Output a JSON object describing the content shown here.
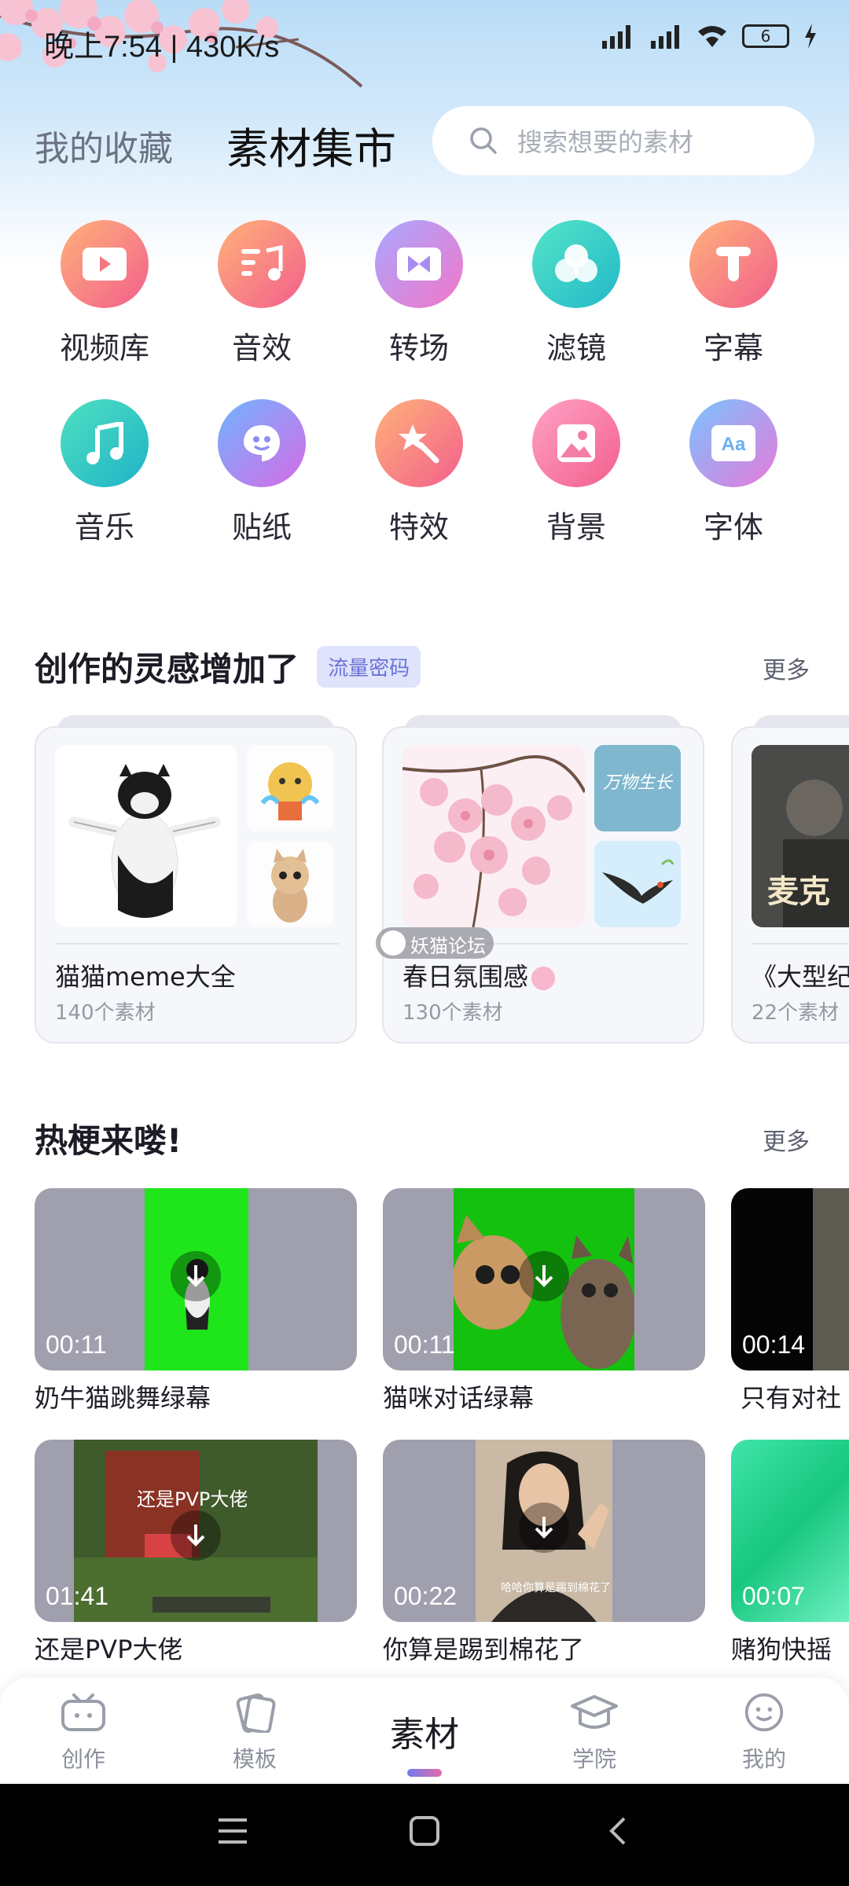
{
  "status_bar": {
    "time": "晚上7:54",
    "speed": "430K/s",
    "battery": "6"
  },
  "header": {
    "tab_favorites": "我的收藏",
    "tab_market": "素材集市",
    "search_placeholder": "搜索想要的素材"
  },
  "categories": [
    {
      "label": "视频库",
      "icon": "video-play-icon"
    },
    {
      "label": "音效",
      "icon": "sound-effect-icon"
    },
    {
      "label": "转场",
      "icon": "transition-icon"
    },
    {
      "label": "滤镜",
      "icon": "filter-icon"
    },
    {
      "label": "字幕",
      "icon": "subtitle-icon"
    },
    {
      "label": "音乐",
      "icon": "music-note-icon"
    },
    {
      "label": "贴纸",
      "icon": "sticker-icon"
    },
    {
      "label": "特效",
      "icon": "magic-wand-icon"
    },
    {
      "label": "背景",
      "icon": "image-icon"
    },
    {
      "label": "字体",
      "icon": "font-aa-icon"
    }
  ],
  "inspiration": {
    "title": "创作的灵感增加了",
    "badge": "流量密码",
    "more": "更多",
    "collections": [
      {
        "title": "猫猫meme大全",
        "count": "140个素材"
      },
      {
        "title": "春日氛围感",
        "count": "130个素材",
        "side_text": "万物生长"
      },
      {
        "title": "《大型纪",
        "count": "22个素材"
      }
    ],
    "watermark": "妖猫论坛"
  },
  "hot": {
    "title": "热梗来喽!",
    "more": "更多",
    "videos": [
      {
        "label": "奶牛猫跳舞绿幕",
        "duration": "00:11"
      },
      {
        "label": "猫咪对话绿幕",
        "duration": "00:11"
      },
      {
        "label": "只有对社",
        "duration": "00:14"
      },
      {
        "label": "还是PVP大佬",
        "duration": "01:41",
        "overlay": "还是PVP大佬"
      },
      {
        "label": "你算是踢到棉花了",
        "duration": "00:22",
        "overlay": "哈哈你算是踢到棉花了"
      },
      {
        "label": "赌狗快摇",
        "duration": "00:07"
      }
    ]
  },
  "bottom_nav": {
    "items": [
      {
        "label": "创作",
        "icon": "tv-robot-icon"
      },
      {
        "label": "模板",
        "icon": "template-cards-icon"
      },
      {
        "label": "素材",
        "icon": ""
      },
      {
        "label": "学院",
        "icon": "graduation-cap-icon"
      },
      {
        "label": "我的",
        "icon": "smiley-face-icon"
      }
    ],
    "active": "素材"
  }
}
